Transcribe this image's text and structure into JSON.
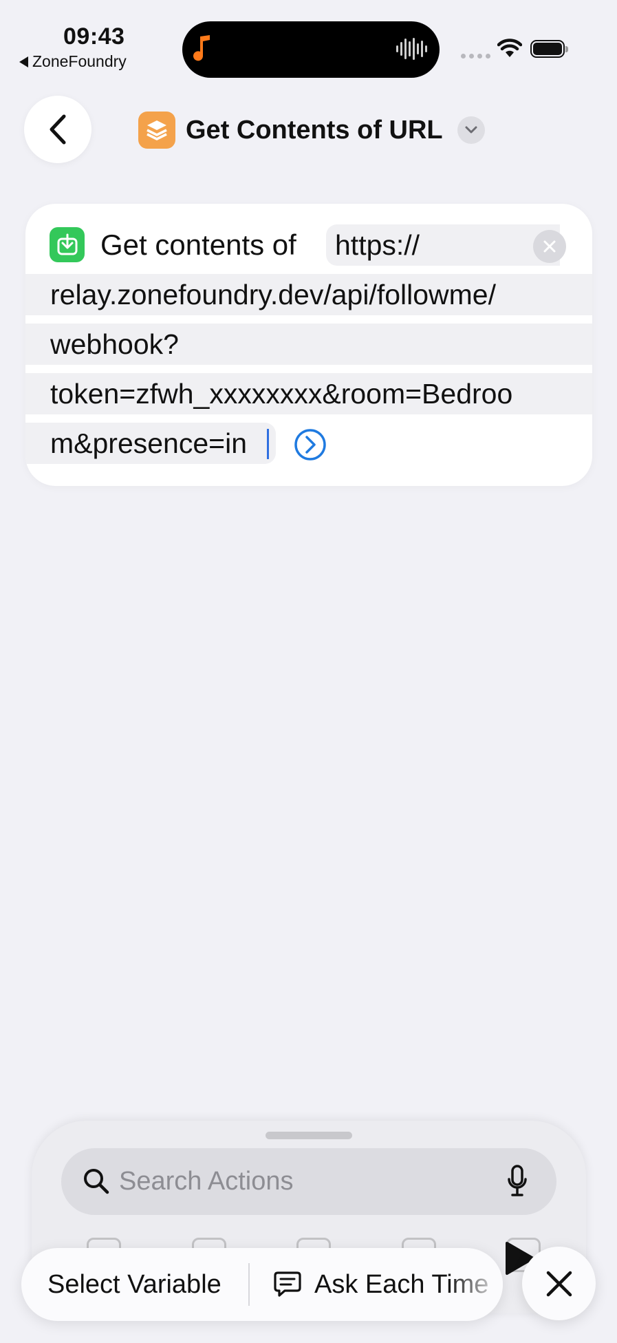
{
  "status_bar": {
    "time": "09:43",
    "back_app": "ZoneFoundry",
    "icons": [
      "music-note-icon",
      "waveform-icon",
      "cellular-signal-icon",
      "wifi-icon",
      "battery-icon"
    ]
  },
  "nav": {
    "title": "Get Contents of URL",
    "icons": [
      "back-chevron-icon",
      "shortcut-layers-icon",
      "chevron-down-icon"
    ]
  },
  "action": {
    "label": "Get contents of",
    "url_lines": [
      "https://",
      "relay.zonefoundry.dev/api/followme/",
      "webhook?",
      "token=zfwh_xxxxxxxx&room=Bedroo",
      "m&presence=in"
    ],
    "icons": [
      "download-icon",
      "clear-icon",
      "go-arrow-icon"
    ]
  },
  "search": {
    "placeholder": "Search Actions",
    "icons": [
      "search-icon",
      "microphone-icon"
    ]
  },
  "bottom_bar": {
    "select_variable": "Select Variable",
    "ask_each_time": "Ask Each Time",
    "icons": [
      "speech-bubble-icon",
      "play-icon",
      "close-icon"
    ]
  },
  "colors": {
    "background": "#f1f1f6",
    "card": "#ffffff",
    "shortcut_icon": "#f4a24b",
    "action_icon": "#33c85a",
    "accent_blue": "#1f7ae0",
    "music_note": "#ff7a1a"
  }
}
